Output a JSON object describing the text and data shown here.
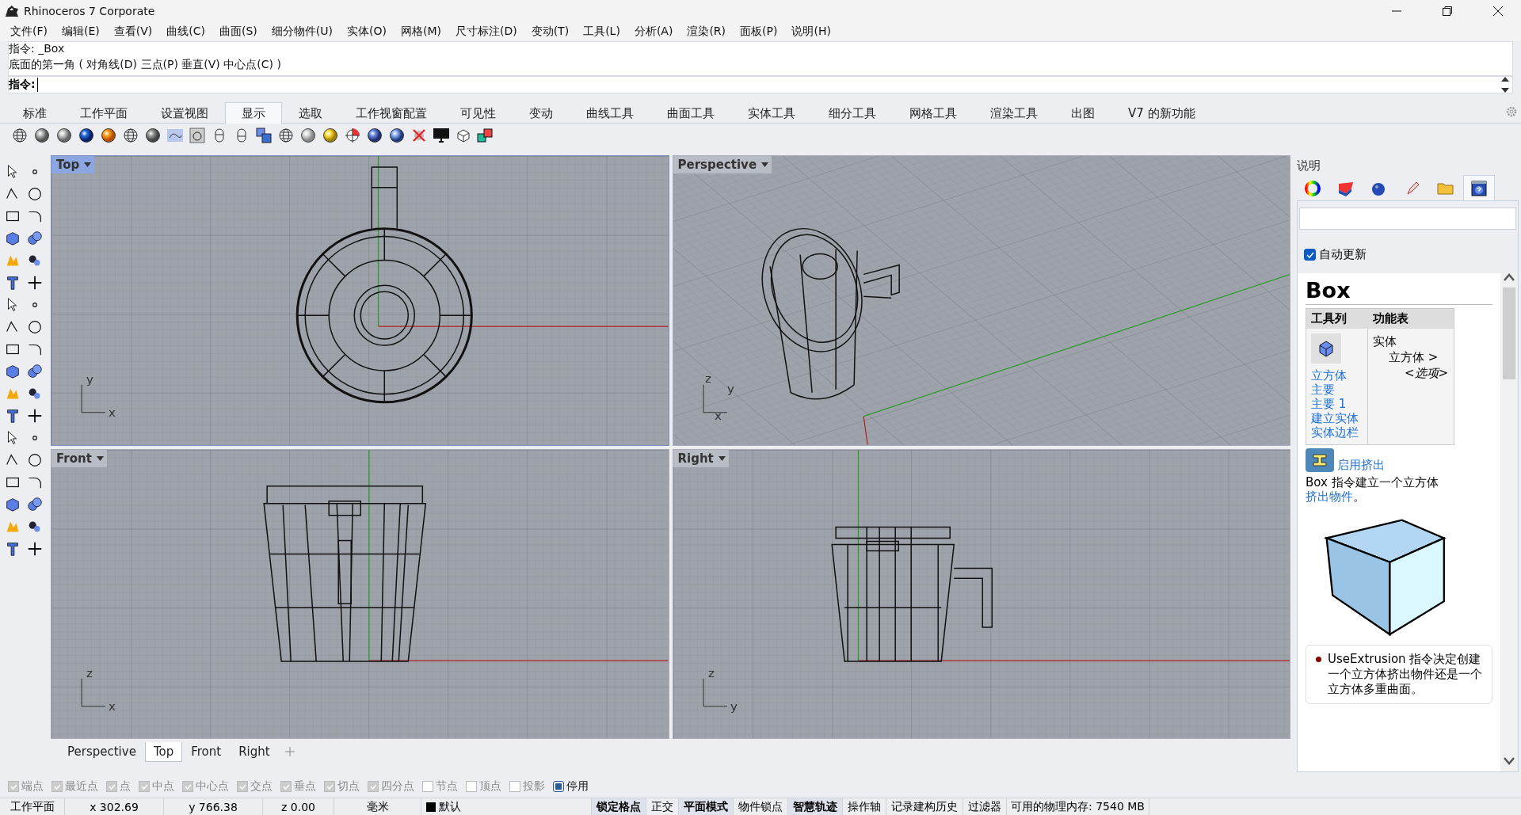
{
  "window": {
    "title": "Rhinoceros 7 Corporate"
  },
  "menu": [
    "文件(F)",
    "编辑(E)",
    "查看(V)",
    "曲线(C)",
    "曲面(S)",
    "细分物件(U)",
    "实体(O)",
    "网格(M)",
    "尺寸标注(D)",
    "变动(T)",
    "工具(L)",
    "分析(A)",
    "渲染(R)",
    "面板(P)",
    "说明(H)"
  ],
  "command": {
    "history": [
      "指令: _Box",
      "底面的第一角 ( 对角线(D)  三点(P)  垂直(V)  中心点(C) )"
    ],
    "prompt": "指令:"
  },
  "toolbar_tabs": [
    {
      "label": "标准",
      "selected": false
    },
    {
      "label": "工作平面",
      "selected": false
    },
    {
      "label": "设置视图",
      "selected": false
    },
    {
      "label": "显示",
      "selected": true
    },
    {
      "label": "选取",
      "selected": false
    },
    {
      "label": "工作视窗配置",
      "selected": false
    },
    {
      "label": "可见性",
      "selected": false
    },
    {
      "label": "变动",
      "selected": false
    },
    {
      "label": "曲线工具",
      "selected": false
    },
    {
      "label": "曲面工具",
      "selected": false
    },
    {
      "label": "实体工具",
      "selected": false
    },
    {
      "label": "细分工具",
      "selected": false
    },
    {
      "label": "网格工具",
      "selected": false
    },
    {
      "label": "渲染工具",
      "selected": false
    },
    {
      "label": "出图",
      "selected": false
    },
    {
      "label": "V7 的新功能",
      "selected": false
    }
  ],
  "viewports": [
    {
      "title": "Top",
      "active": true,
      "kind": "top",
      "axes": [
        "y",
        "x"
      ]
    },
    {
      "title": "Perspective",
      "active": false,
      "kind": "perspective",
      "axes": [
        "z",
        "y",
        "x"
      ]
    },
    {
      "title": "Front",
      "active": false,
      "kind": "front",
      "axes": [
        "z",
        "x"
      ]
    },
    {
      "title": "Right",
      "active": false,
      "kind": "right",
      "axes": [
        "z",
        "y"
      ]
    }
  ],
  "viewport_tabs": [
    {
      "label": "Perspective",
      "selected": false
    },
    {
      "label": "Top",
      "selected": true
    },
    {
      "label": "Front",
      "selected": false
    },
    {
      "label": "Right",
      "selected": false
    }
  ],
  "osnaps": [
    {
      "label": "端点",
      "checked": true
    },
    {
      "label": "最近点",
      "checked": true
    },
    {
      "label": "点",
      "checked": true
    },
    {
      "label": "中点",
      "checked": true
    },
    {
      "label": "中心点",
      "checked": true
    },
    {
      "label": "交点",
      "checked": true
    },
    {
      "label": "垂点",
      "checked": true
    },
    {
      "label": "切点",
      "checked": true
    },
    {
      "label": "四分点",
      "checked": true
    },
    {
      "label": "节点",
      "checked": false
    },
    {
      "label": "顶点",
      "checked": false
    },
    {
      "label": "投影",
      "checked": false
    }
  ],
  "osnap_disable": {
    "label": "停用",
    "checked": true
  },
  "status": {
    "cplane": "工作平面",
    "x": "x 302.69",
    "y": "y 766.38",
    "z": "z 0.00",
    "units": "毫米",
    "layer": "默认",
    "toggles": [
      {
        "label": "锁定格点",
        "on": true
      },
      {
        "label": "正交",
        "on": false
      },
      {
        "label": "平面模式",
        "on": true
      },
      {
        "label": "物件锁点",
        "on": false
      },
      {
        "label": "智慧轨迹",
        "on": true
      },
      {
        "label": "操作轴",
        "on": false
      },
      {
        "label": "记录建构历史",
        "on": false
      },
      {
        "label": "过滤器",
        "on": false
      }
    ],
    "memory": "可用的物理内存: 7540 MB"
  },
  "panel": {
    "title": "说明",
    "tabs": [
      {
        "kind": "color",
        "selected": false
      },
      {
        "kind": "layers",
        "selected": false
      },
      {
        "kind": "material",
        "selected": false
      },
      {
        "kind": "brush",
        "selected": false
      },
      {
        "kind": "folder",
        "selected": false
      },
      {
        "kind": "help",
        "selected": true
      }
    ],
    "auto_update": {
      "label": "自动更新",
      "checked": true
    },
    "help": {
      "title": "Box",
      "headers": [
        "工具列",
        "功能表"
      ],
      "toolbar_links": [
        "立方体",
        "主要",
        "主要 1",
        "建立实体",
        "实体边栏"
      ],
      "menu_path": [
        "实体",
        "立方体 >",
        "<选项>"
      ],
      "extrusion_link": "启用挤出",
      "description": {
        "text": "Box 指令建立一个立方体",
        "link": "挤出物件",
        "end": "。"
      },
      "note": "UseExtrusion 指令决定创建一个立方体挤出物件还是一个立方体多重曲面。"
    }
  }
}
